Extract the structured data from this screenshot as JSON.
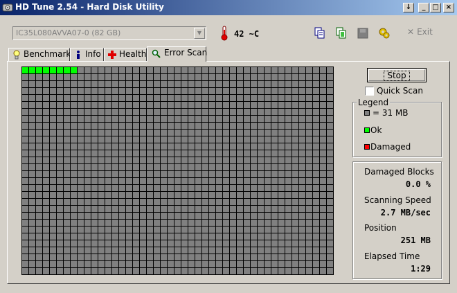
{
  "window": {
    "title": "HD Tune 2.54 - Hard Disk Utility",
    "buttons": {
      "restore": "↓",
      "minimize": "_",
      "maximize": "□",
      "close": "×"
    }
  },
  "toolbar": {
    "drive": "IC35L080AVVA07-0 (82 GB)",
    "temperature": "42 ~C",
    "exit_label": "Exit",
    "icons": [
      "copy-icon",
      "copy-all-icon",
      "save-icon",
      "options-icon"
    ]
  },
  "tabs": [
    {
      "label": "Benchmark",
      "icon": "benchmark-icon"
    },
    {
      "label": "Info",
      "icon": "info-icon"
    },
    {
      "label": "Health",
      "icon": "health-icon"
    },
    {
      "label": "Error Scan",
      "icon": "search-icon",
      "active": true
    }
  ],
  "scan": {
    "columns": 45,
    "rows": 30,
    "blocks_scanned_ok": 8,
    "colors": {
      "unscanned": "#808080",
      "ok": "#00ff00",
      "damaged": "#ff0000",
      "grid": "#000000"
    }
  },
  "controls": {
    "stop_label": "Stop",
    "quick_scan_label": "Quick Scan",
    "quick_scan_checked": false
  },
  "legend": {
    "title": "Legend",
    "items": [
      {
        "label": "= 31 MB",
        "color": "#808080"
      },
      {
        "label": "Ok",
        "color": "#00ff00"
      },
      {
        "label": "Damaged",
        "color": "#ff0000"
      }
    ]
  },
  "stats": {
    "damaged_blocks_label": "Damaged Blocks",
    "damaged_blocks_value": "0.0 %",
    "scanning_speed_label": "Scanning Speed",
    "scanning_speed_value": "2.7 MB/sec",
    "position_label": "Position",
    "position_value": "251 MB",
    "elapsed_time_label": "Elapsed Time",
    "elapsed_time_value": "1:29"
  }
}
